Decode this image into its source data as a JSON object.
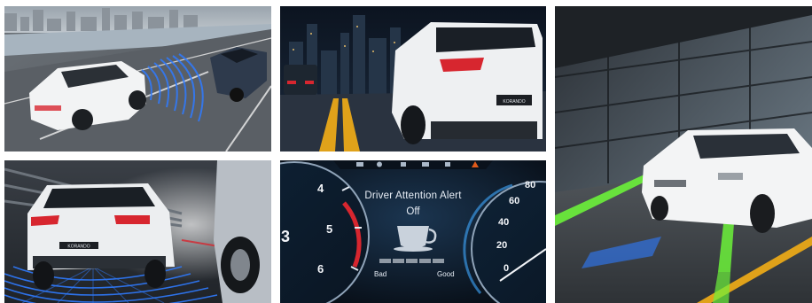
{
  "gallery": {
    "tiles": [
      {
        "name": "tile-blind-spot-detection"
      },
      {
        "name": "tile-night-rear-view"
      },
      {
        "name": "tile-lane-keeping-assist"
      },
      {
        "name": "tile-rear-cross-traffic"
      },
      {
        "name": "tile-driver-attention-alert"
      }
    ]
  },
  "rear_badge": "KORANDO",
  "cluster": {
    "alert_title": "Driver Attention Alert",
    "alert_state": "Off",
    "level_low_label": "Bad",
    "level_high_label": "Good",
    "left_gauge_numbers": [
      "4",
      "5",
      "6",
      "3"
    ],
    "right_gauge_numbers": [
      "80",
      "60",
      "40",
      "20",
      "0"
    ]
  },
  "colors": {
    "radar_blue": "#2f7bff",
    "lane_green": "#6cf23a",
    "taillight_red": "#d7262f",
    "lane_yellow": "#e0a21a"
  }
}
